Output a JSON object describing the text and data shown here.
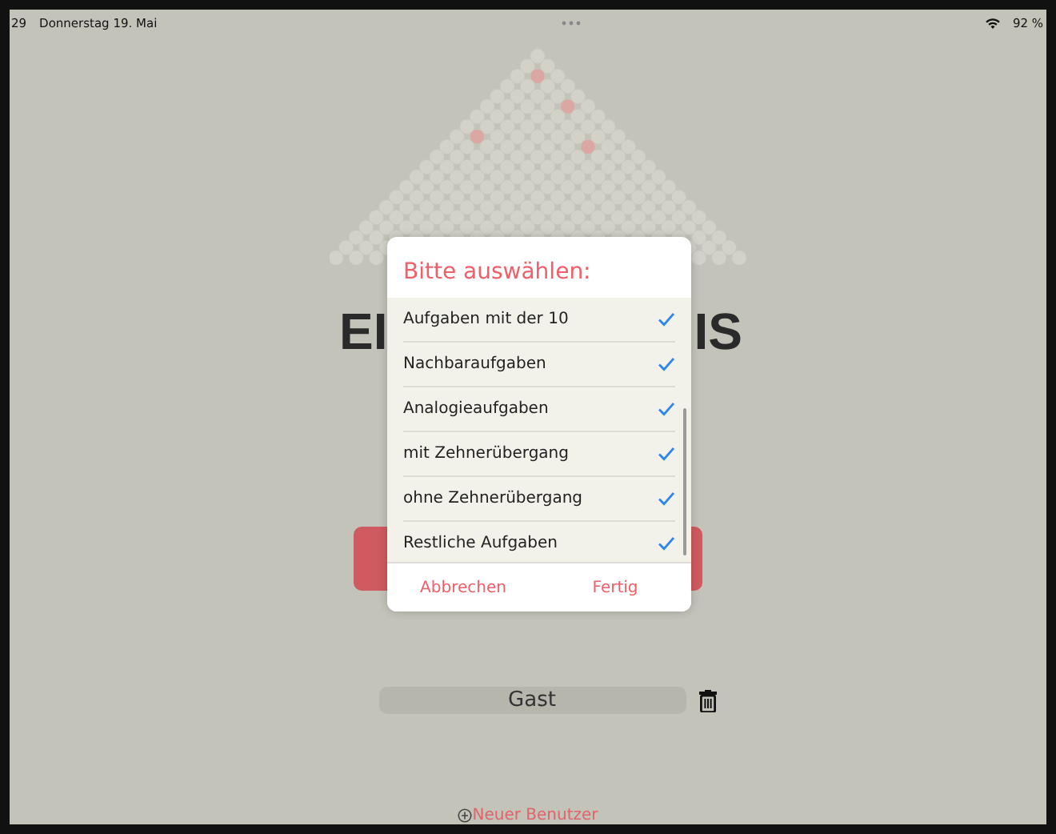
{
  "status_bar": {
    "time": "29",
    "date": "Donnerstag 19. Mai",
    "battery": "92 %"
  },
  "title_fragments": [
    "EI",
    "IS"
  ],
  "dialog": {
    "title": "Bitte auswählen:",
    "items": [
      {
        "label": "Aufgaben mit der 10",
        "checked": true
      },
      {
        "label": "Nachbaraufgaben",
        "checked": true
      },
      {
        "label": "Analogieaufgaben",
        "checked": true
      },
      {
        "label": "mit Zehnerübergang",
        "checked": true
      },
      {
        "label": "ohne Zehnerübergang",
        "checked": true
      },
      {
        "label": "Restliche Aufgaben",
        "checked": true
      }
    ],
    "buttons": [
      {
        "label": "Abbrechen"
      },
      {
        "label": "Fertig"
      }
    ]
  },
  "user_field": {
    "value": "Gast"
  },
  "new_user_link": {
    "label": "Neuer Benutzer"
  }
}
